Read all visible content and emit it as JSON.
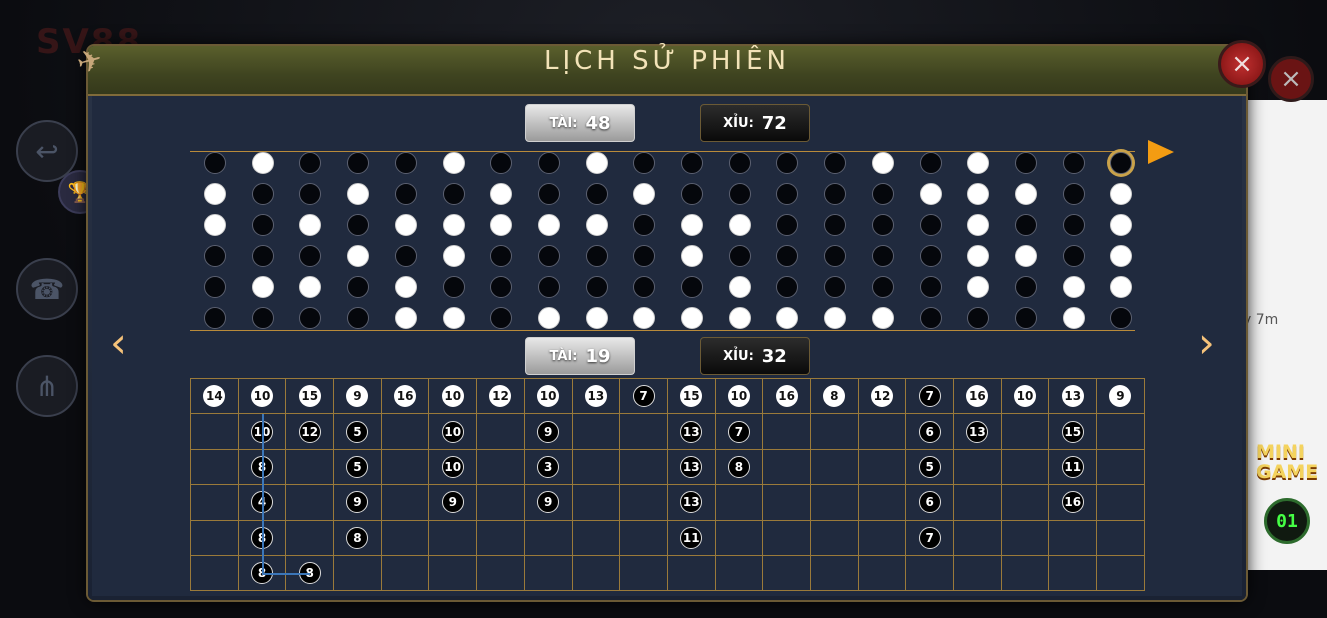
{
  "dialog": {
    "title": "LỊCH SỬ PHIÊN",
    "close_icon": "×"
  },
  "summary_top": {
    "tai_label": "TÀI:",
    "tai_value": "48",
    "xiu_label": "XỈU:",
    "xiu_value": "72"
  },
  "summary_bottom": {
    "tai_label": "TÀI:",
    "tai_value": "19",
    "xiu_label": "XỈU:",
    "xiu_value": "32"
  },
  "background": {
    "logo_text": "SV88",
    "side_text": "y 7m",
    "mini_game_label": "MINI GAME",
    "mini_game_count": "01"
  },
  "dice_history": [
    [
      "b",
      "w",
      "w",
      "b",
      "b",
      "b"
    ],
    [
      "w",
      "b",
      "b",
      "b",
      "w",
      "b"
    ],
    [
      "b",
      "b",
      "w",
      "b",
      "w",
      "b"
    ],
    [
      "b",
      "w",
      "b",
      "w",
      "b",
      "b"
    ],
    [
      "b",
      "b",
      "w",
      "b",
      "w",
      "w"
    ],
    [
      "w",
      "b",
      "w",
      "w",
      "b",
      "w"
    ],
    [
      "b",
      "w",
      "w",
      "b",
      "b",
      "b"
    ],
    [
      "b",
      "b",
      "w",
      "b",
      "b",
      "w"
    ],
    [
      "w",
      "b",
      "w",
      "b",
      "b",
      "w"
    ],
    [
      "b",
      "w",
      "b",
      "b",
      "b",
      "w"
    ],
    [
      "b",
      "b",
      "w",
      "w",
      "b",
      "w"
    ],
    [
      "b",
      "b",
      "w",
      "b",
      "w",
      "w"
    ],
    [
      "b",
      "b",
      "b",
      "b",
      "b",
      "w"
    ],
    [
      "b",
      "b",
      "b",
      "b",
      "b",
      "w"
    ],
    [
      "w",
      "b",
      "b",
      "b",
      "b",
      "w"
    ],
    [
      "b",
      "w",
      "b",
      "b",
      "b",
      "b"
    ],
    [
      "w",
      "w",
      "w",
      "w",
      "w",
      "b"
    ],
    [
      "b",
      "w",
      "b",
      "w",
      "b",
      "b"
    ],
    [
      "b",
      "b",
      "b",
      "b",
      "w",
      "w"
    ],
    [
      "b",
      "w",
      "w",
      "w",
      "w",
      "b"
    ]
  ],
  "score_grid": [
    [
      {
        "v": "14",
        "c": "w"
      },
      {
        "v": "10",
        "c": "w"
      },
      {
        "v": "15",
        "c": "w"
      },
      {
        "v": "9",
        "c": "w"
      },
      {
        "v": "16",
        "c": "w"
      },
      {
        "v": "10",
        "c": "w"
      },
      {
        "v": "12",
        "c": "w"
      },
      {
        "v": "10",
        "c": "w"
      },
      {
        "v": "13",
        "c": "w"
      },
      {
        "v": "7",
        "c": "b"
      },
      {
        "v": "15",
        "c": "w"
      },
      {
        "v": "10",
        "c": "w"
      },
      {
        "v": "16",
        "c": "w"
      },
      {
        "v": "8",
        "c": "w"
      },
      {
        "v": "12",
        "c": "w"
      },
      {
        "v": "7",
        "c": "b"
      },
      {
        "v": "16",
        "c": "w"
      },
      {
        "v": "10",
        "c": "w"
      },
      {
        "v": "13",
        "c": "w"
      },
      {
        "v": "9",
        "c": "w"
      }
    ],
    [
      null,
      {
        "v": "10",
        "c": "b"
      },
      {
        "v": "12",
        "c": "b"
      },
      {
        "v": "5",
        "c": "b"
      },
      null,
      {
        "v": "10",
        "c": "b"
      },
      null,
      {
        "v": "9",
        "c": "b"
      },
      null,
      null,
      {
        "v": "13",
        "c": "b"
      },
      {
        "v": "7",
        "c": "b"
      },
      null,
      null,
      null,
      {
        "v": "6",
        "c": "b"
      },
      {
        "v": "13",
        "c": "b"
      },
      null,
      {
        "v": "15",
        "c": "b"
      },
      null
    ],
    [
      null,
      {
        "v": "8",
        "c": "b"
      },
      null,
      {
        "v": "5",
        "c": "b"
      },
      null,
      {
        "v": "10",
        "c": "b"
      },
      null,
      {
        "v": "3",
        "c": "b"
      },
      null,
      null,
      {
        "v": "13",
        "c": "b"
      },
      {
        "v": "8",
        "c": "b"
      },
      null,
      null,
      null,
      {
        "v": "5",
        "c": "b"
      },
      null,
      null,
      {
        "v": "11",
        "c": "b"
      },
      null
    ],
    [
      null,
      {
        "v": "4",
        "c": "b"
      },
      null,
      {
        "v": "9",
        "c": "b"
      },
      null,
      {
        "v": "9",
        "c": "b"
      },
      null,
      {
        "v": "9",
        "c": "b"
      },
      null,
      null,
      {
        "v": "13",
        "c": "b"
      },
      null,
      null,
      null,
      null,
      {
        "v": "6",
        "c": "b"
      },
      null,
      null,
      {
        "v": "16",
        "c": "b"
      },
      null
    ],
    [
      null,
      {
        "v": "8",
        "c": "b"
      },
      null,
      {
        "v": "8",
        "c": "b"
      },
      null,
      null,
      null,
      null,
      null,
      null,
      {
        "v": "11",
        "c": "b"
      },
      null,
      null,
      null,
      null,
      {
        "v": "7",
        "c": "b"
      },
      null,
      null,
      null,
      null
    ],
    [
      null,
      {
        "v": "8",
        "c": "b"
      },
      {
        "v": "8",
        "c": "b"
      },
      null,
      null,
      null,
      null,
      null,
      null,
      null,
      null,
      null,
      null,
      null,
      null,
      null,
      null,
      null,
      null,
      null
    ]
  ]
}
